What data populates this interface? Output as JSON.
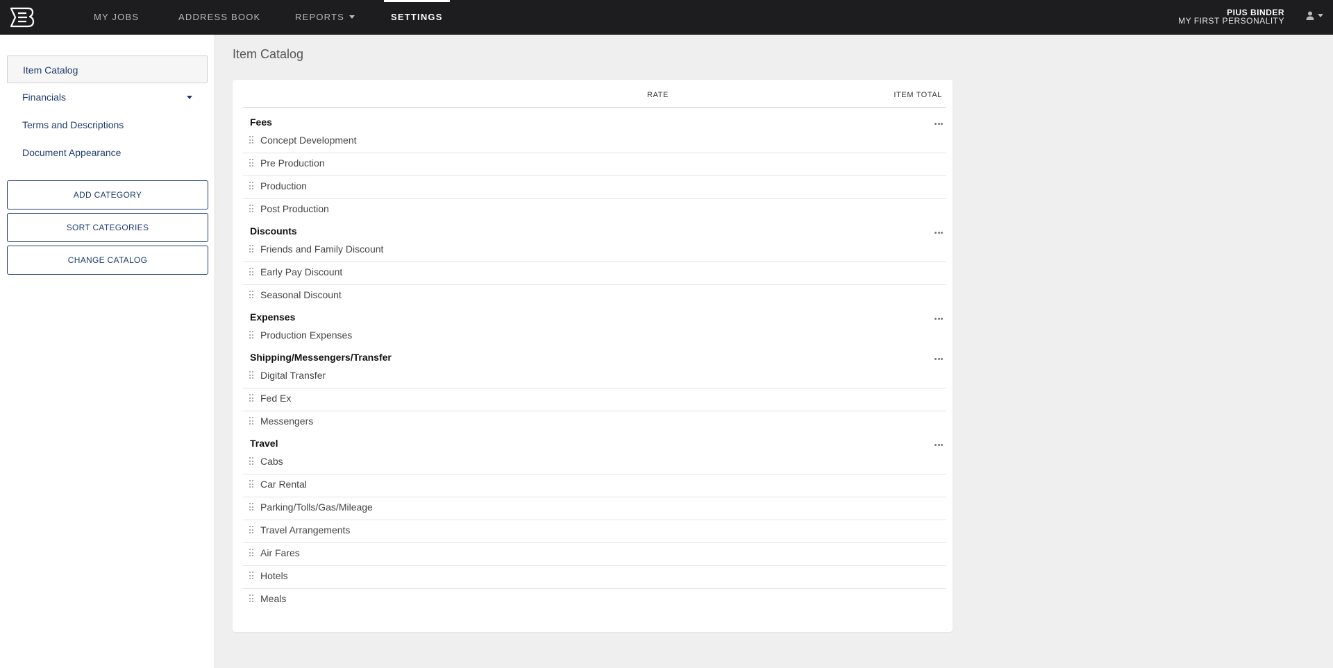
{
  "nav": {
    "items": [
      {
        "label": "MY JOBS"
      },
      {
        "label": "ADDRESS BOOK"
      },
      {
        "label": "REPORTS"
      },
      {
        "label": "SETTINGS"
      }
    ],
    "user_name": "PIUS BINDER",
    "user_company": "MY FIRST PERSONALITY"
  },
  "sidebar": {
    "items": [
      {
        "label": "Item Catalog"
      },
      {
        "label": "Financials"
      },
      {
        "label": "Terms and Descriptions"
      },
      {
        "label": "Document Appearance"
      }
    ],
    "buttons": [
      "ADD CATEGORY",
      "SORT CATEGORIES",
      "CHANGE CATALOG"
    ]
  },
  "main": {
    "title": "Item Catalog",
    "columns": {
      "rate": "RATE",
      "item_total": "ITEM TOTAL"
    },
    "categories": [
      {
        "name": "Fees",
        "items": [
          "Concept Development",
          "Pre Production",
          "Production",
          "Post Production"
        ]
      },
      {
        "name": "Discounts",
        "items": [
          "Friends and Family Discount",
          "Early Pay Discount",
          "Seasonal Discount"
        ]
      },
      {
        "name": "Expenses",
        "items": [
          "Production Expenses"
        ]
      },
      {
        "name": "Shipping/Messengers/Transfer",
        "items": [
          "Digital Transfer",
          "Fed Ex",
          "Messengers"
        ]
      },
      {
        "name": "Travel",
        "items": [
          "Cabs",
          "Car Rental",
          "Parking/Tolls/Gas/Mileage",
          "Travel Arrangements",
          "Air Fares",
          "Hotels",
          "Meals"
        ]
      }
    ]
  },
  "colors": {
    "topbar": "#1d1d1f",
    "accent": "#1e3b6e",
    "background": "#efefef"
  }
}
